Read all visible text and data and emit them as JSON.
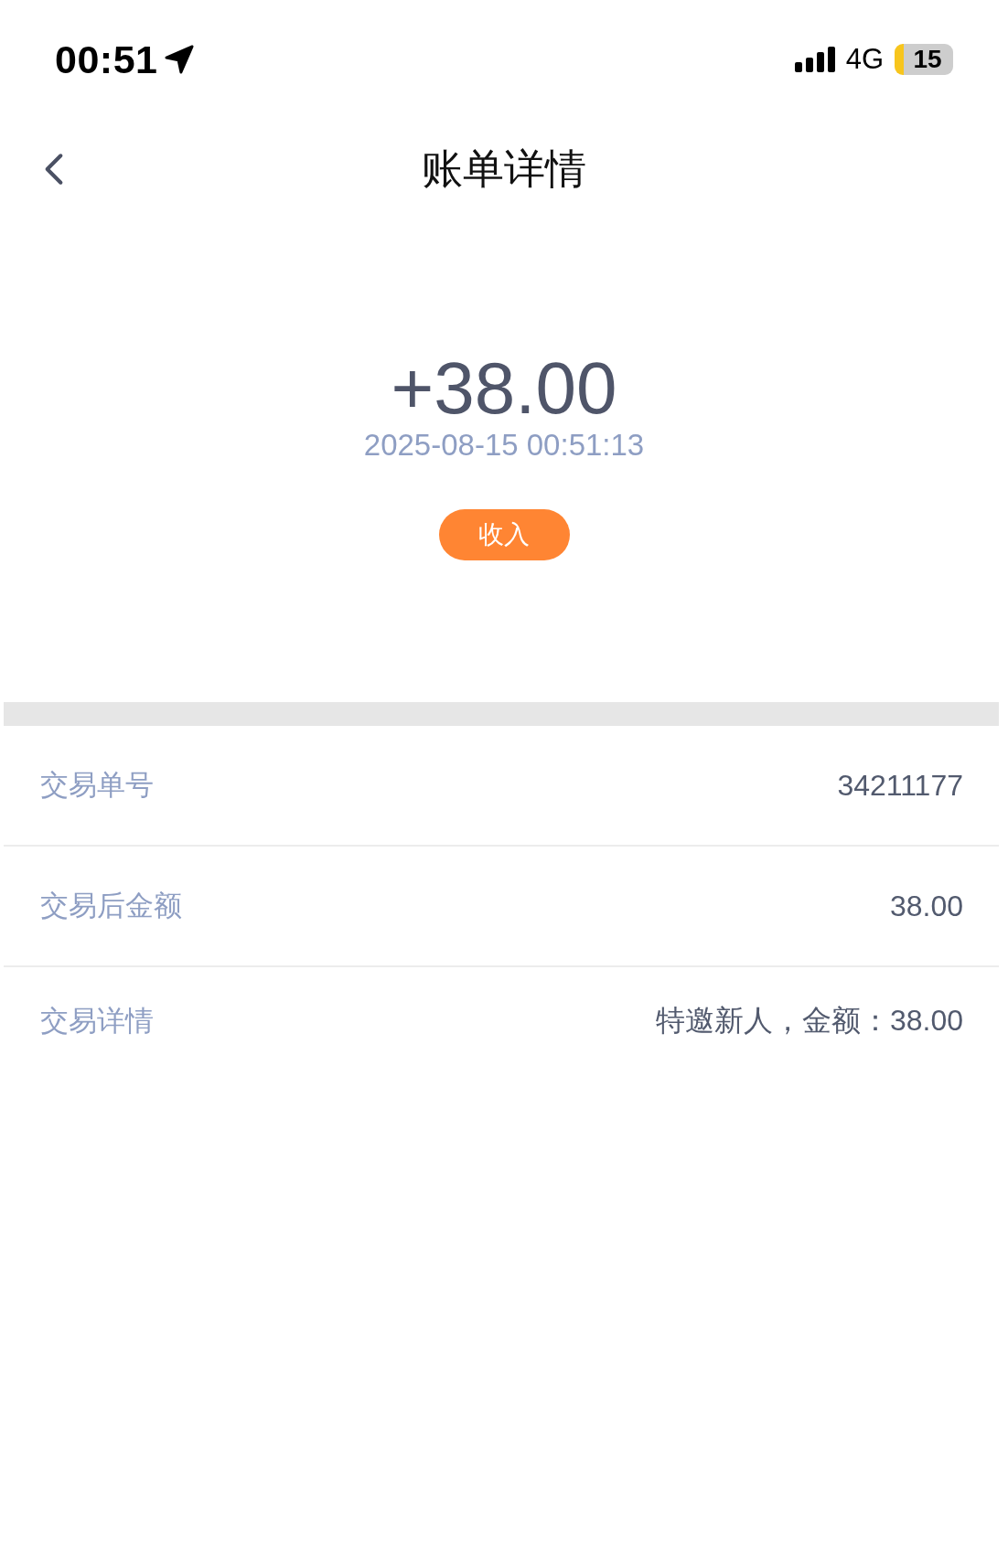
{
  "status_bar": {
    "time": "00:51",
    "network": "4G",
    "battery": "15"
  },
  "nav": {
    "title": "账单详情"
  },
  "summary": {
    "amount": "+38.00",
    "datetime": "2025-08-15 00:51:13",
    "tag": "收入"
  },
  "details": [
    {
      "label": "交易单号",
      "value": "34211177"
    },
    {
      "label": "交易后金额",
      "value": "38.00"
    },
    {
      "label": "交易详情",
      "value": "特邀新人，金额：38.00"
    }
  ]
}
